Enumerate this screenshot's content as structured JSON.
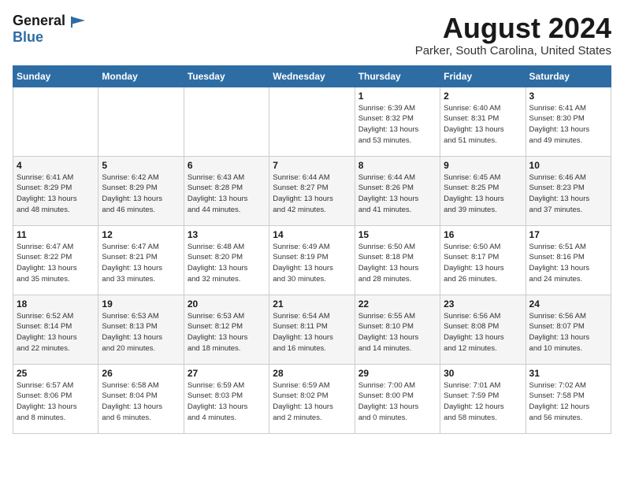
{
  "logo": {
    "line1": "General",
    "line2": "Blue"
  },
  "title": "August 2024",
  "subtitle": "Parker, South Carolina, United States",
  "days_of_week": [
    "Sunday",
    "Monday",
    "Tuesday",
    "Wednesday",
    "Thursday",
    "Friday",
    "Saturday"
  ],
  "weeks": [
    [
      {
        "day": "",
        "info": ""
      },
      {
        "day": "",
        "info": ""
      },
      {
        "day": "",
        "info": ""
      },
      {
        "day": "",
        "info": ""
      },
      {
        "day": "1",
        "info": "Sunrise: 6:39 AM\nSunset: 8:32 PM\nDaylight: 13 hours\nand 53 minutes."
      },
      {
        "day": "2",
        "info": "Sunrise: 6:40 AM\nSunset: 8:31 PM\nDaylight: 13 hours\nand 51 minutes."
      },
      {
        "day": "3",
        "info": "Sunrise: 6:41 AM\nSunset: 8:30 PM\nDaylight: 13 hours\nand 49 minutes."
      }
    ],
    [
      {
        "day": "4",
        "info": "Sunrise: 6:41 AM\nSunset: 8:29 PM\nDaylight: 13 hours\nand 48 minutes."
      },
      {
        "day": "5",
        "info": "Sunrise: 6:42 AM\nSunset: 8:29 PM\nDaylight: 13 hours\nand 46 minutes."
      },
      {
        "day": "6",
        "info": "Sunrise: 6:43 AM\nSunset: 8:28 PM\nDaylight: 13 hours\nand 44 minutes."
      },
      {
        "day": "7",
        "info": "Sunrise: 6:44 AM\nSunset: 8:27 PM\nDaylight: 13 hours\nand 42 minutes."
      },
      {
        "day": "8",
        "info": "Sunrise: 6:44 AM\nSunset: 8:26 PM\nDaylight: 13 hours\nand 41 minutes."
      },
      {
        "day": "9",
        "info": "Sunrise: 6:45 AM\nSunset: 8:25 PM\nDaylight: 13 hours\nand 39 minutes."
      },
      {
        "day": "10",
        "info": "Sunrise: 6:46 AM\nSunset: 8:23 PM\nDaylight: 13 hours\nand 37 minutes."
      }
    ],
    [
      {
        "day": "11",
        "info": "Sunrise: 6:47 AM\nSunset: 8:22 PM\nDaylight: 13 hours\nand 35 minutes."
      },
      {
        "day": "12",
        "info": "Sunrise: 6:47 AM\nSunset: 8:21 PM\nDaylight: 13 hours\nand 33 minutes."
      },
      {
        "day": "13",
        "info": "Sunrise: 6:48 AM\nSunset: 8:20 PM\nDaylight: 13 hours\nand 32 minutes."
      },
      {
        "day": "14",
        "info": "Sunrise: 6:49 AM\nSunset: 8:19 PM\nDaylight: 13 hours\nand 30 minutes."
      },
      {
        "day": "15",
        "info": "Sunrise: 6:50 AM\nSunset: 8:18 PM\nDaylight: 13 hours\nand 28 minutes."
      },
      {
        "day": "16",
        "info": "Sunrise: 6:50 AM\nSunset: 8:17 PM\nDaylight: 13 hours\nand 26 minutes."
      },
      {
        "day": "17",
        "info": "Sunrise: 6:51 AM\nSunset: 8:16 PM\nDaylight: 13 hours\nand 24 minutes."
      }
    ],
    [
      {
        "day": "18",
        "info": "Sunrise: 6:52 AM\nSunset: 8:14 PM\nDaylight: 13 hours\nand 22 minutes."
      },
      {
        "day": "19",
        "info": "Sunrise: 6:53 AM\nSunset: 8:13 PM\nDaylight: 13 hours\nand 20 minutes."
      },
      {
        "day": "20",
        "info": "Sunrise: 6:53 AM\nSunset: 8:12 PM\nDaylight: 13 hours\nand 18 minutes."
      },
      {
        "day": "21",
        "info": "Sunrise: 6:54 AM\nSunset: 8:11 PM\nDaylight: 13 hours\nand 16 minutes."
      },
      {
        "day": "22",
        "info": "Sunrise: 6:55 AM\nSunset: 8:10 PM\nDaylight: 13 hours\nand 14 minutes."
      },
      {
        "day": "23",
        "info": "Sunrise: 6:56 AM\nSunset: 8:08 PM\nDaylight: 13 hours\nand 12 minutes."
      },
      {
        "day": "24",
        "info": "Sunrise: 6:56 AM\nSunset: 8:07 PM\nDaylight: 13 hours\nand 10 minutes."
      }
    ],
    [
      {
        "day": "25",
        "info": "Sunrise: 6:57 AM\nSunset: 8:06 PM\nDaylight: 13 hours\nand 8 minutes."
      },
      {
        "day": "26",
        "info": "Sunrise: 6:58 AM\nSunset: 8:04 PM\nDaylight: 13 hours\nand 6 minutes."
      },
      {
        "day": "27",
        "info": "Sunrise: 6:59 AM\nSunset: 8:03 PM\nDaylight: 13 hours\nand 4 minutes."
      },
      {
        "day": "28",
        "info": "Sunrise: 6:59 AM\nSunset: 8:02 PM\nDaylight: 13 hours\nand 2 minutes."
      },
      {
        "day": "29",
        "info": "Sunrise: 7:00 AM\nSunset: 8:00 PM\nDaylight: 13 hours\nand 0 minutes."
      },
      {
        "day": "30",
        "info": "Sunrise: 7:01 AM\nSunset: 7:59 PM\nDaylight: 12 hours\nand 58 minutes."
      },
      {
        "day": "31",
        "info": "Sunrise: 7:02 AM\nSunset: 7:58 PM\nDaylight: 12 hours\nand 56 minutes."
      }
    ]
  ]
}
